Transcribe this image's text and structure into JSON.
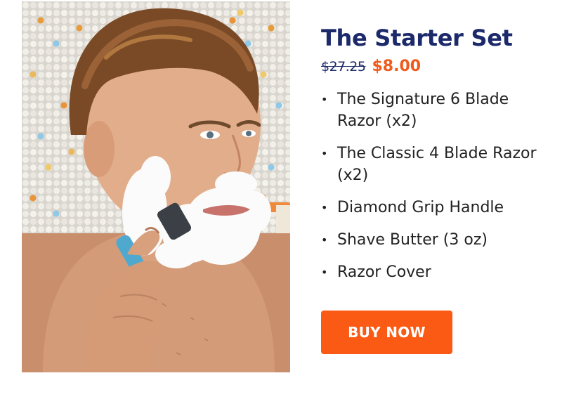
{
  "product": {
    "title": "The Starter Set",
    "original_price": "$27.25",
    "sale_price": "$8.00",
    "items": [
      "The Signature 6 Blade Razor (x2)",
      "The Classic 4 Blade Razor (x2)",
      "Diamond Grip Handle",
      "Shave Butter (3 oz)",
      "Razor Cover"
    ],
    "bullet": "•",
    "cta_label": "BUY NOW"
  },
  "colors": {
    "title": "#1c2a6b",
    "sale_price": "#f05a1a",
    "cta_background": "#fa5a13"
  },
  "image": {
    "icon": "man-shaving-photo"
  }
}
